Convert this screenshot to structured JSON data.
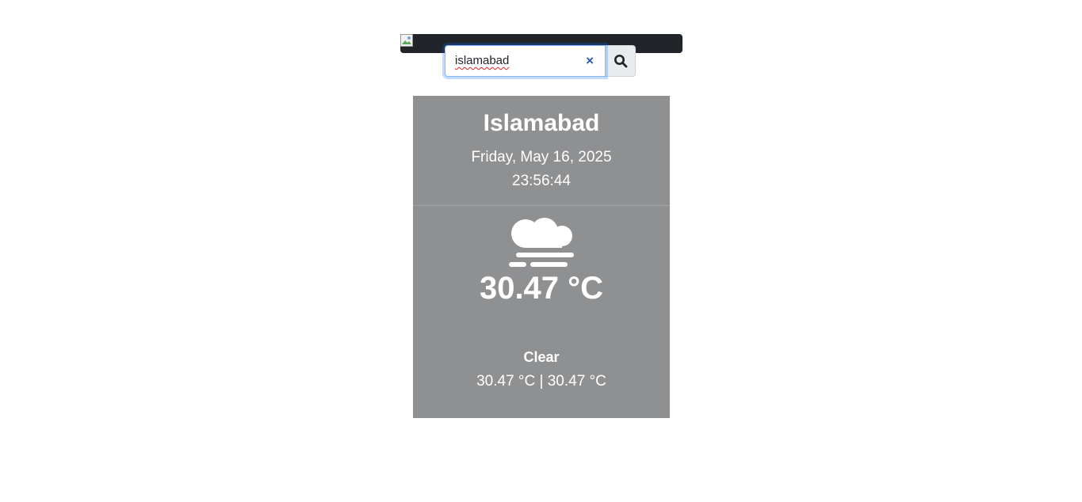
{
  "header": {
    "broken_image_icon": "broken-image-icon"
  },
  "search": {
    "value": "islamabad",
    "clear_label": "×",
    "button_icon": "search-icon"
  },
  "weather": {
    "city": "Islamabad",
    "date": "Friday, May 16, 2025",
    "time": "23:56:44",
    "icon": "fog-icon",
    "temperature": "30.47 °C",
    "condition": "Clear",
    "range": "30.47 °C | 30.47 °C"
  },
  "colors": {
    "card_background": "#8f9092",
    "topbar": "#212529",
    "text": "#ffffff",
    "input_focus": "#86b7fe"
  }
}
